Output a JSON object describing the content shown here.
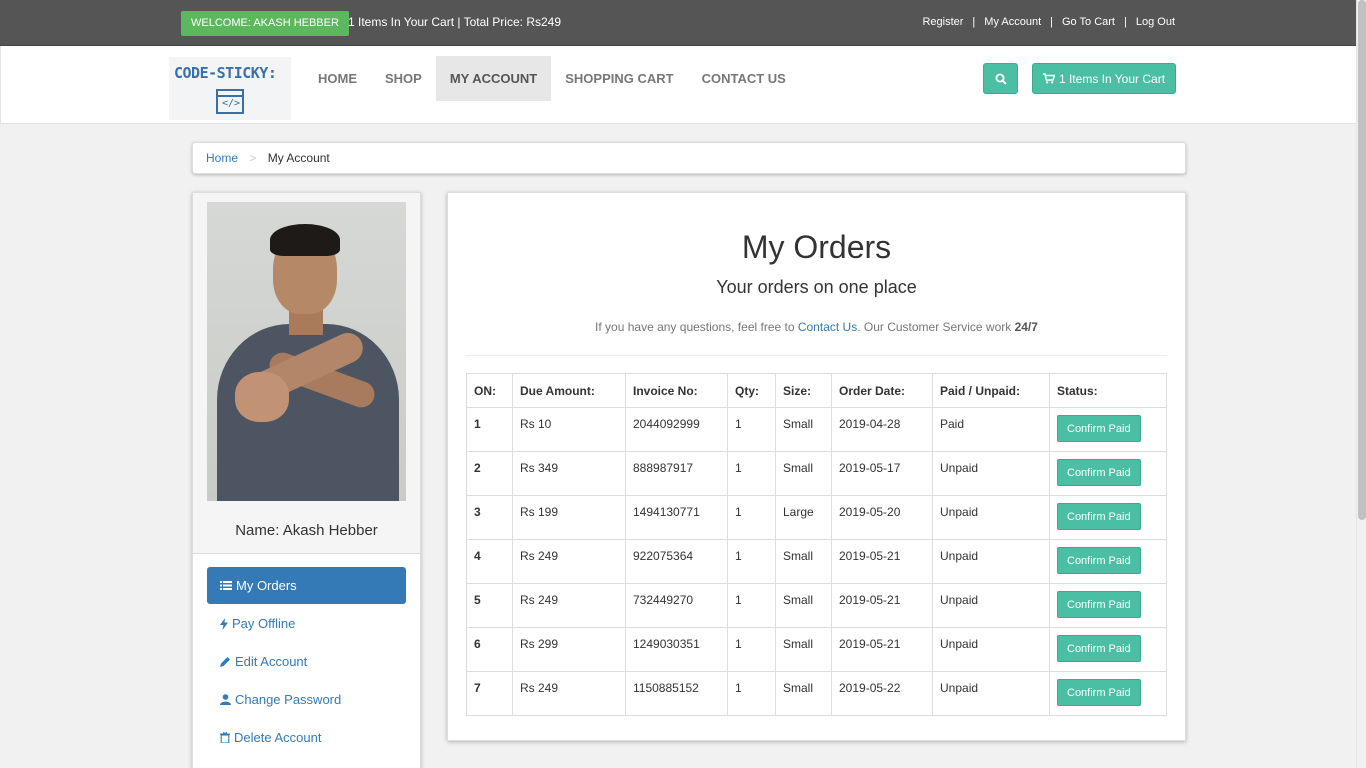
{
  "topbar": {
    "welcome": "WELCOME: AKASH HEBBER",
    "cart_summary": "1 Items In Your Cart | Total Price: Rs249",
    "links": [
      "Register",
      "My Account",
      "Go To Cart",
      "Log Out"
    ],
    "separator": "|"
  },
  "header": {
    "logo_text": "CODE-STICKY:",
    "logo_icon_text": "</>",
    "nav": [
      "HOME",
      "SHOP",
      "MY ACCOUNT",
      "SHOPPING CART",
      "CONTACT US"
    ],
    "active_nav": "MY ACCOUNT",
    "cart_button": "1 Items In Your Cart",
    "icons": {
      "search": "search-icon",
      "cart": "cart-icon"
    }
  },
  "breadcrumb": {
    "home": "Home",
    "separator": ">",
    "current": "My Account"
  },
  "sidebar": {
    "name": "Name: Akash Hebber",
    "menu": [
      {
        "label": "My Orders",
        "icon": "list-icon",
        "active": true
      },
      {
        "label": "Pay Offline",
        "icon": "bolt-icon",
        "active": false
      },
      {
        "label": "Edit Account",
        "icon": "pencil-icon",
        "active": false
      },
      {
        "label": "Change Password",
        "icon": "user-icon",
        "active": false
      },
      {
        "label": "Delete Account",
        "icon": "trash-icon",
        "active": false
      }
    ]
  },
  "main": {
    "title": "My Orders",
    "subtitle": "Your orders on one place",
    "help_prefix": "If you have any questions, feel free to ",
    "help_link": "Contact Us",
    "help_middle": ". Our Customer Service work ",
    "help_bold": "24/7",
    "table": {
      "headers": [
        "ON:",
        "Due Amount:",
        "Invoice No:",
        "Qty:",
        "Size:",
        "Order Date:",
        "Paid / Unpaid:",
        "Status:"
      ],
      "rows": [
        {
          "on": "1",
          "amount": "Rs 10",
          "invoice": "2044092999",
          "qty": "1",
          "size": "Small",
          "date": "2019-04-28",
          "paid": "Paid",
          "status": "Confirm Paid"
        },
        {
          "on": "2",
          "amount": "Rs 349",
          "invoice": "888987917",
          "qty": "1",
          "size": "Small",
          "date": "2019-05-17",
          "paid": "Unpaid",
          "status": "Confirm Paid"
        },
        {
          "on": "3",
          "amount": "Rs 199",
          "invoice": "1494130771",
          "qty": "1",
          "size": "Large",
          "date": "2019-05-20",
          "paid": "Unpaid",
          "status": "Confirm Paid"
        },
        {
          "on": "4",
          "amount": "Rs 249",
          "invoice": "922075364",
          "qty": "1",
          "size": "Small",
          "date": "2019-05-21",
          "paid": "Unpaid",
          "status": "Confirm Paid"
        },
        {
          "on": "5",
          "amount": "Rs 249",
          "invoice": "732449270",
          "qty": "1",
          "size": "Small",
          "date": "2019-05-21",
          "paid": "Unpaid",
          "status": "Confirm Paid"
        },
        {
          "on": "6",
          "amount": "Rs 299",
          "invoice": "1249030351",
          "qty": "1",
          "size": "Small",
          "date": "2019-05-21",
          "paid": "Unpaid",
          "status": "Confirm Paid"
        },
        {
          "on": "7",
          "amount": "Rs 249",
          "invoice": "1150885152",
          "qty": "1",
          "size": "Small",
          "date": "2019-05-22",
          "paid": "Unpaid",
          "status": "Confirm Paid"
        }
      ]
    }
  },
  "colors": {
    "topbar": "#555555",
    "welcome_badge": "#5cb85c",
    "teal_button": "#4bbfa4",
    "link_blue": "#337ab7"
  }
}
